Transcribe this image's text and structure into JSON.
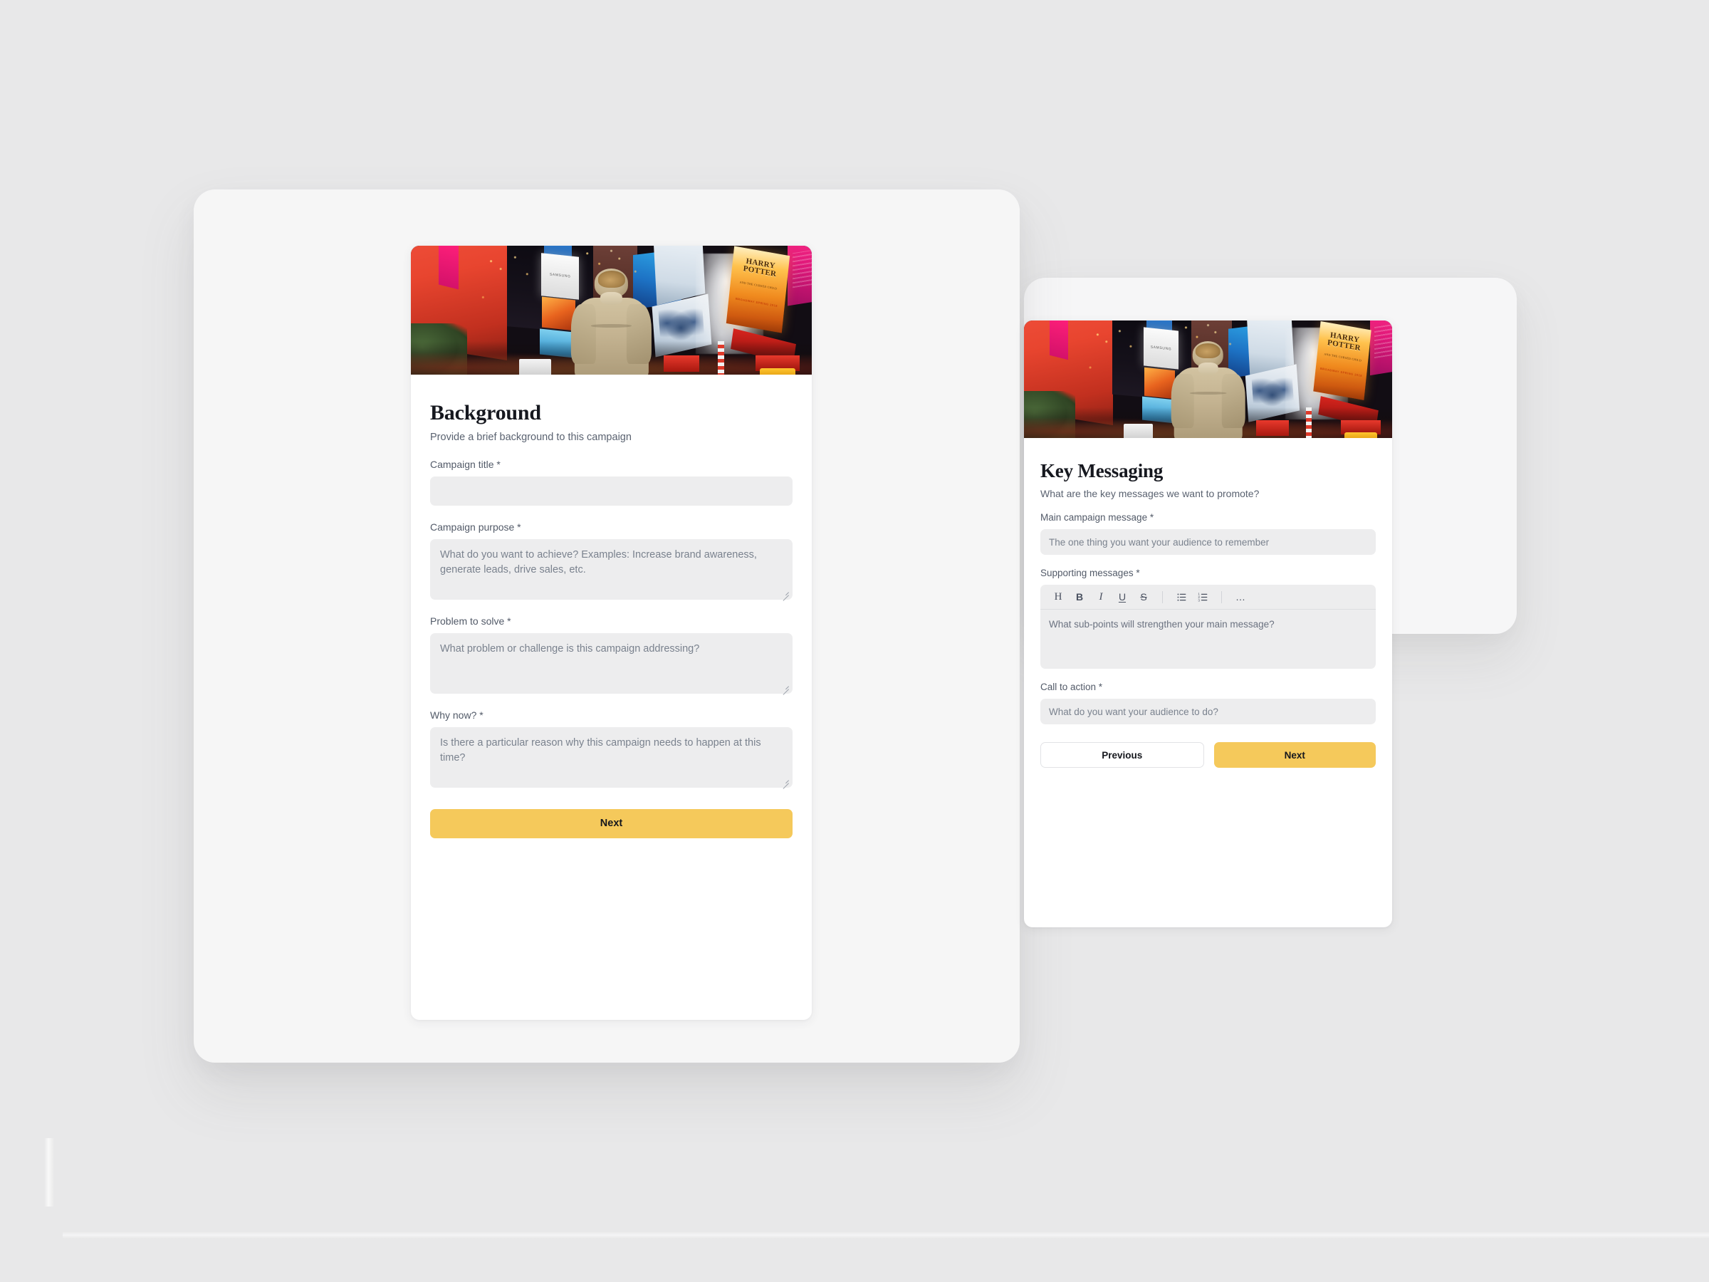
{
  "theme": {
    "background": "#e8e8e9",
    "panel": "#f6f6f6",
    "card": "#ffffff",
    "field": "#ededee",
    "accent_yellow": "#f5c95b",
    "text_primary": "#16181f",
    "text_muted": "#5a6270",
    "placeholder": "#7a828e"
  },
  "hero_image": {
    "alt": "Person in beige hoodie seen from behind looking up at illuminated Times Square billboards at night",
    "billboard_texts": {
      "samsung": "SAMSUNG",
      "harry_potter_title": "HARRY POTTER",
      "harry_potter_subtitle": "AND THE CURSED CHILD",
      "harry_potter_note": "BROADWAY SPRING 2018"
    }
  },
  "card_background": {
    "title": "Background",
    "subtitle": "Provide a brief background to this campaign",
    "fields": [
      {
        "label": "Campaign title *",
        "type": "input",
        "value": "",
        "placeholder": ""
      },
      {
        "label": "Campaign purpose *",
        "type": "textarea",
        "value": "",
        "placeholder": "What do you want to achieve? Examples: Increase brand awareness, generate leads, drive sales, etc."
      },
      {
        "label": "Problem to solve *",
        "type": "textarea",
        "value": "",
        "placeholder": "What problem or challenge is this campaign addressing?"
      },
      {
        "label": "Why now? *",
        "type": "textarea",
        "value": "",
        "placeholder": "Is there a particular reason why this campaign needs to happen at this time?"
      }
    ],
    "next_label": "Next"
  },
  "card_key_messaging": {
    "title": "Key Messaging",
    "subtitle": "What are the key messages we want to promote?",
    "fields": [
      {
        "label": "Main campaign message *",
        "type": "input",
        "value": "",
        "placeholder": "The one thing you want your audience to remember"
      },
      {
        "label": "Supporting messages *",
        "type": "richtext",
        "value": "",
        "placeholder": "What sub-points will strengthen your main message?"
      },
      {
        "label": "Call to action *",
        "type": "input",
        "value": "",
        "placeholder": "What do you want your audience to do?"
      }
    ],
    "toolbar": [
      {
        "icon": "heading-icon",
        "glyph": "H"
      },
      {
        "icon": "bold-icon",
        "glyph": "B"
      },
      {
        "icon": "italic-icon",
        "glyph": "I"
      },
      {
        "icon": "underline-icon",
        "glyph": "U"
      },
      {
        "icon": "strikethrough-icon",
        "glyph": "S"
      },
      {
        "icon": "bulleted-list-icon",
        "glyph": ""
      },
      {
        "icon": "numbered-list-icon",
        "glyph": ""
      },
      {
        "icon": "more-options-icon",
        "glyph": "…"
      }
    ],
    "previous_label": "Previous",
    "next_label": "Next"
  }
}
